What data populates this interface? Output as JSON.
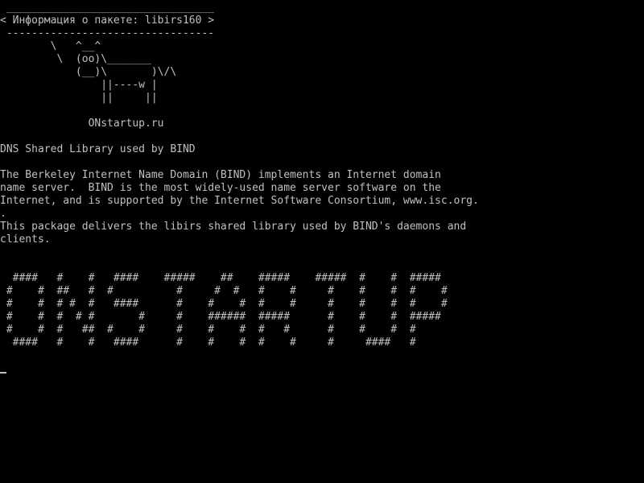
{
  "terminal": {
    "bubble": {
      "top_border": " _________________________________",
      "title": "< Информация о пакете: libirs160 >",
      "bottom_border": " ---------------------------------"
    },
    "cow": [
      "        \\   ^__^",
      "         \\  (oo)\\_______",
      "            (__)\\       )\\/\\",
      "                ||----w |",
      "                ||     ||"
    ],
    "site": "              ONstartup.ru",
    "description": {
      "summary": "DNS Shared Library used by BIND",
      "lines": [
        "The Berkeley Internet Name Domain (BIND) implements an Internet domain",
        "name server.  BIND is the most widely-used name server software on the",
        "Internet, and is supported by the Internet Software Consortium, www.isc.org.",
        ".",
        "This package delivers the libirs shared library used by BIND's daemons and",
        "clients."
      ]
    },
    "banner": [
      "  ####   #    #   ####    #####    ##    #####    #####  #    #  #####",
      " #    #  ##   #  #          #     #  #   #    #     #    #    #  #    #",
      " #    #  # #  #   ####      #    #    #  #    #     #    #    #  #    #",
      " #    #  #  # #       #     #    ######  #####      #    #    #  #####",
      " #    #  #   ##  #    #     #    #    #  #   #      #    #    #  #",
      "  ####   #    #   ####      #    #    #  #    #     #     ####   #"
    ]
  }
}
